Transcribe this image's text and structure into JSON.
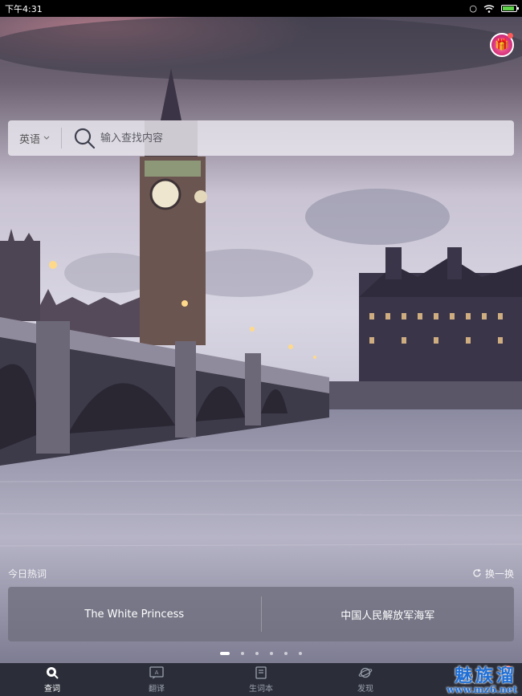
{
  "status_bar": {
    "time": "下午4:31"
  },
  "search": {
    "language": "英语",
    "placeholder": "输入查找内容"
  },
  "hot_words": {
    "title": "今日热词",
    "refresh_label": "换一换",
    "items": [
      "The White Princess",
      "中国人民解放军海军"
    ]
  },
  "pager": {
    "total": 6,
    "active": 1
  },
  "nav": {
    "items": [
      {
        "label": "查词",
        "icon": "search-icon"
      },
      {
        "label": "翻译",
        "icon": "translate-icon"
      },
      {
        "label": "生词本",
        "icon": "notebook-icon"
      },
      {
        "label": "发现",
        "icon": "planet-icon"
      },
      {
        "label": "",
        "icon": "user-icon"
      }
    ],
    "active_index": 0
  },
  "watermark": {
    "text": "魅族溜",
    "url": "www.mz6.net"
  },
  "colors": {
    "nav_bg": "#2b2e39",
    "accent": "#ffffff",
    "badge": "#ff4a4a"
  }
}
